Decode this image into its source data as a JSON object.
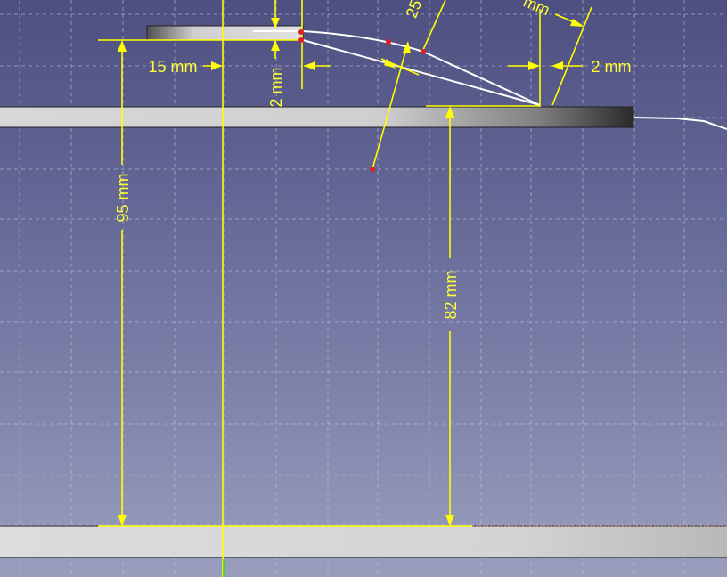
{
  "view": {
    "background_top": "#4d4f80",
    "background_bottom": "#9a9ebd",
    "dimension_color": "#ffff00",
    "sketch_color": "#ffffff",
    "point_color": "#e02020"
  },
  "dimensions": {
    "horizontal_left": "15 mm",
    "vertical_small": "2 mm",
    "horizontal_right": "2 mm",
    "vertical_left": "95 mm",
    "vertical_right": "82 mm",
    "angle_partial": "25",
    "diagonal_partial": "mm"
  }
}
